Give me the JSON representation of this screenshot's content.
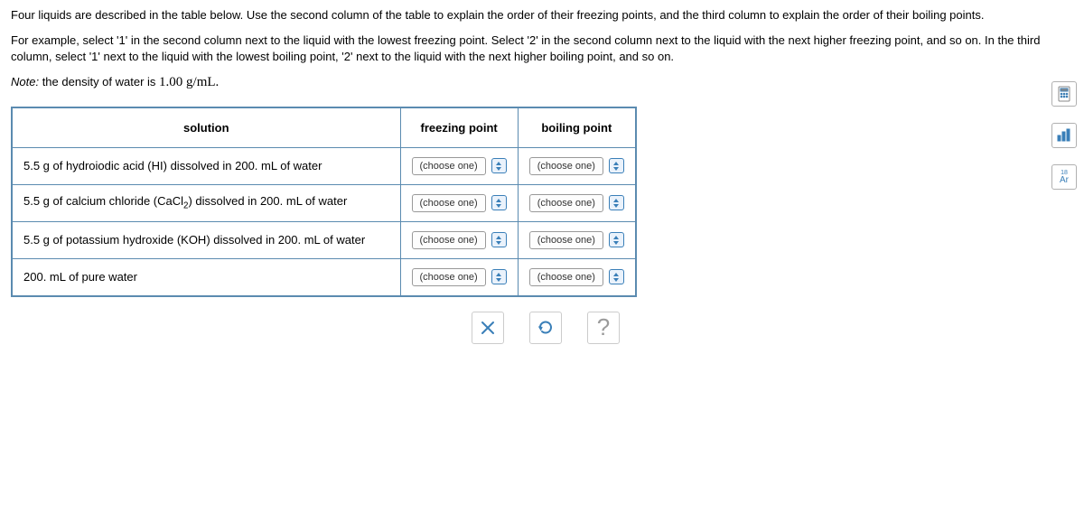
{
  "instructions": {
    "para1": "Four liquids are described in the table below. Use the second column of the table to explain the order of their freezing points, and the third column to explain the order of their boiling points.",
    "para2": "For example, select '1' in the second column next to the liquid with the lowest freezing point. Select '2' in the second column next to the liquid with the next higher freezing point, and so on. In the third column, select '1' next to the liquid with the lowest boiling point, '2' next to the liquid with the next higher boiling point, and so on.",
    "note_prefix": "Note:",
    "note_text": " the density of water is ",
    "note_value": "1.00 g/mL."
  },
  "table": {
    "headers": {
      "solution": "solution",
      "freezing": "freezing point",
      "boiling": "boiling point"
    },
    "rows": [
      {
        "solution_prefix": "5.5 g of hydroiodic acid (HI) dissolved in 200. mL of water",
        "freezing_placeholder": "(choose one)",
        "boiling_placeholder": "(choose one)"
      },
      {
        "solution_prefix": "5.5 g of calcium chloride (CaCl",
        "solution_sub": "2",
        "solution_suffix": ") dissolved in 200. mL of water",
        "freezing_placeholder": "(choose one)",
        "boiling_placeholder": "(choose one)"
      },
      {
        "solution_prefix": "5.5 g of potassium hydroxide (KOH) dissolved in 200. mL of water",
        "freezing_placeholder": "(choose one)",
        "boiling_placeholder": "(choose one)"
      },
      {
        "solution_prefix": "200. mL of pure water",
        "freezing_placeholder": "(choose one)",
        "boiling_placeholder": "(choose one)"
      }
    ]
  },
  "actions": {
    "clear": "×",
    "reset": "↺",
    "help": "?"
  },
  "tools": {
    "calculator": "calc",
    "graph": "graph",
    "periodic": "Ar"
  }
}
